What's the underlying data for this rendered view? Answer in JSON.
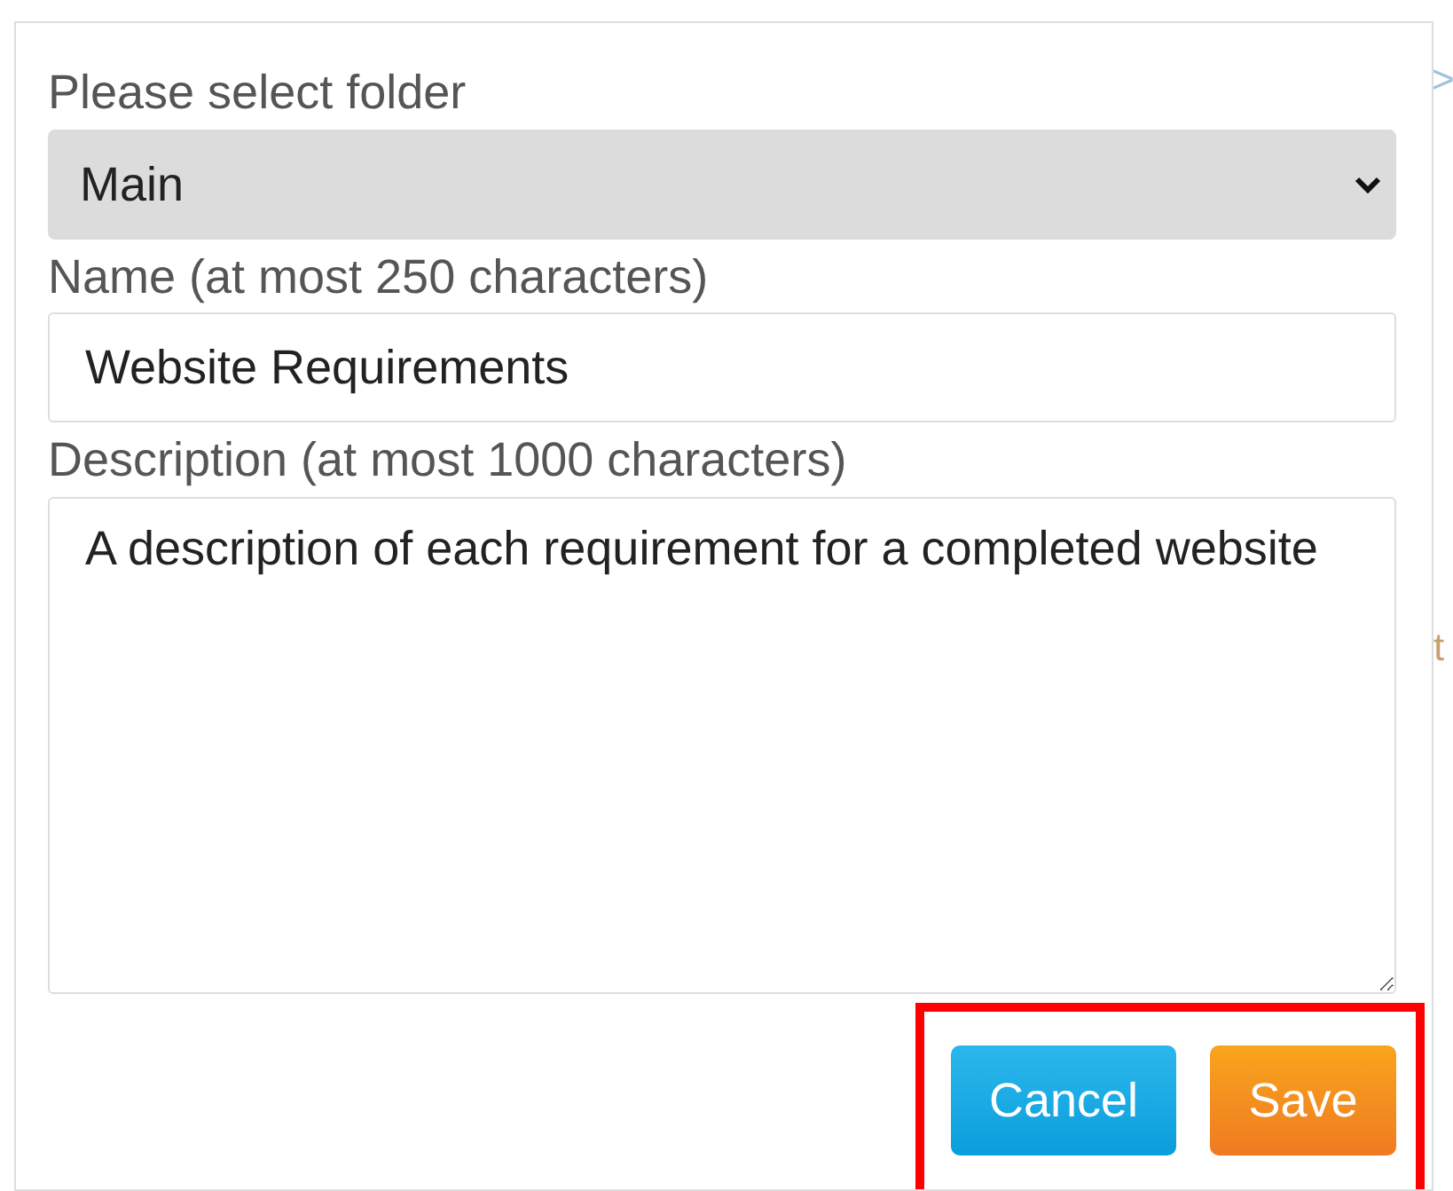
{
  "background": {
    "fragments": [
      ">",
      "t"
    ]
  },
  "dialog": {
    "folder": {
      "label": "Please select folder",
      "value": "Main"
    },
    "name": {
      "label": "Name (at most 250 characters)",
      "value": "Website Requirements"
    },
    "description": {
      "label": "Description (at most 1000 characters)",
      "value": "A description of each requirement for a completed website"
    },
    "actions": {
      "highlighted": true,
      "buttons": [
        {
          "label": "Cancel",
          "kind": "secondary"
        },
        {
          "label": "Save",
          "kind": "primary"
        }
      ]
    }
  }
}
